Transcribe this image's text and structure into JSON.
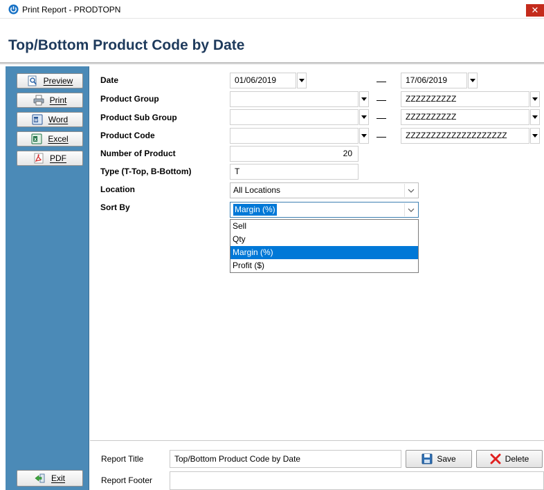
{
  "window": {
    "title": "Print Report - PRODTOPN",
    "close_glyph": "✕"
  },
  "report": {
    "heading": "Top/Bottom Product Code by Date"
  },
  "sidebar": {
    "items": [
      {
        "label": "Preview",
        "icon": "preview-icon"
      },
      {
        "label": "Print",
        "icon": "printer-icon"
      },
      {
        "label": "Word",
        "icon": "word-icon"
      },
      {
        "label": "Excel",
        "icon": "excel-icon"
      },
      {
        "label": "PDF",
        "icon": "pdf-icon"
      }
    ],
    "exit": {
      "label": "Exit",
      "icon": "exit-icon"
    }
  },
  "form": {
    "date": {
      "label": "Date",
      "from": "01/06/2019",
      "to": "17/06/2019"
    },
    "product_group": {
      "label": "Product Group",
      "from": "",
      "to": "ZZZZZZZZZZ"
    },
    "product_sub_group": {
      "label": "Product Sub Group",
      "from": "",
      "to": "ZZZZZZZZZZ"
    },
    "product_code": {
      "label": "Product Code",
      "from": "",
      "to": "ZZZZZZZZZZZZZZZZZZZZ"
    },
    "number_of_product": {
      "label": "Number of Product",
      "value": "20"
    },
    "type": {
      "label": "Type (T-Top, B-Bottom)",
      "value": "T"
    },
    "location": {
      "label": "Location",
      "value": "All Locations"
    },
    "sort_by": {
      "label": "Sort By",
      "value": "Margin (%)",
      "options": [
        "Sell",
        "Qty",
        "Margin (%)",
        "Profit ($)"
      ],
      "selected_index": 2
    }
  },
  "footer": {
    "report_title": {
      "label": "Report Title",
      "value": "Top/Bottom Product Code by Date"
    },
    "report_footer": {
      "label": "Report Footer",
      "value": ""
    },
    "save_label": "Save",
    "delete_label": "Delete"
  },
  "colors": {
    "sidebar": "#4b8ab7",
    "heading": "#1e3a5c",
    "selection": "#0078d7",
    "close": "#c42b1c"
  }
}
